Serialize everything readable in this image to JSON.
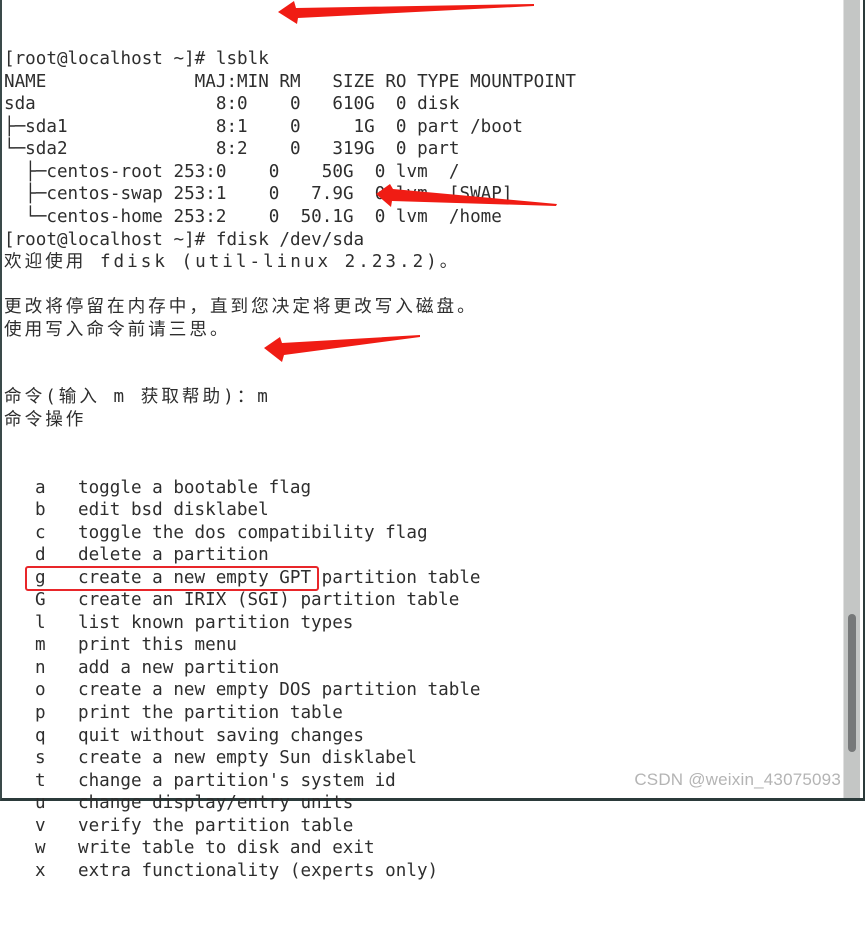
{
  "terminal": {
    "lines": [
      {
        "text": "[root@localhost ~]# lsblk"
      },
      {
        "text": "NAME              MAJ:MIN RM   SIZE RO TYPE MOUNTPOINT"
      },
      {
        "text": "sda                 8:0    0   610G  0 disk"
      },
      {
        "text": "├─sda1              8:1    0     1G  0 part /boot"
      },
      {
        "text": "└─sda2              8:2    0   319G  0 part"
      },
      {
        "text": "  ├─centos-root 253:0    0    50G  0 lvm  /"
      },
      {
        "text": "  ├─centos-swap 253:1    0   7.9G  0 lvm  [SWAP]"
      },
      {
        "text": "  └─centos-home 253:2    0  50.1G  0 lvm  /home"
      },
      {
        "text": "[root@localhost ~]# fdisk /dev/sda"
      },
      {
        "text": "欢迎使用 fdisk (util-linux 2.23.2)。"
      },
      {
        "text": ""
      },
      {
        "text": "更改将停留在内存中，直到您决定将更改写入磁盘。"
      },
      {
        "text": "使用写入命令前请三思。"
      },
      {
        "text": ""
      },
      {
        "text": ""
      },
      {
        "text": "命令(输入 m 获取帮助)：m"
      },
      {
        "text": "命令操作"
      }
    ],
    "menu": [
      {
        "key": "a",
        "desc": "toggle a bootable flag"
      },
      {
        "key": "b",
        "desc": "edit bsd disklabel"
      },
      {
        "key": "c",
        "desc": "toggle the dos compatibility flag"
      },
      {
        "key": "d",
        "desc": "delete a partition"
      },
      {
        "key": "g",
        "desc": "create a new empty GPT partition table"
      },
      {
        "key": "G",
        "desc": "create an IRIX (SGI) partition table"
      },
      {
        "key": "l",
        "desc": "list known partition types"
      },
      {
        "key": "m",
        "desc": "print this menu"
      },
      {
        "key": "n",
        "desc": "add a new partition"
      },
      {
        "key": "o",
        "desc": "create a new empty DOS partition table"
      },
      {
        "key": "p",
        "desc": "print the partition table"
      },
      {
        "key": "q",
        "desc": "quit without saving changes"
      },
      {
        "key": "s",
        "desc": "create a new empty Sun disklabel"
      },
      {
        "key": "t",
        "desc": "change a partition's system id"
      },
      {
        "key": "u",
        "desc": "change display/entry units"
      },
      {
        "key": "v",
        "desc": "verify the partition table"
      },
      {
        "key": "w",
        "desc": "write table to disk and exit"
      },
      {
        "key": "x",
        "desc": "extra functionality (experts only)"
      }
    ]
  },
  "annotations": {
    "highlighted_menu_key": "n",
    "arrow_color": "#f01c14",
    "box_color": "#e8262a",
    "arrow_targets": [
      "lsblk command",
      "fdisk /dev/sda command",
      "m input"
    ]
  },
  "watermark": "CSDN @weixin_43075093"
}
